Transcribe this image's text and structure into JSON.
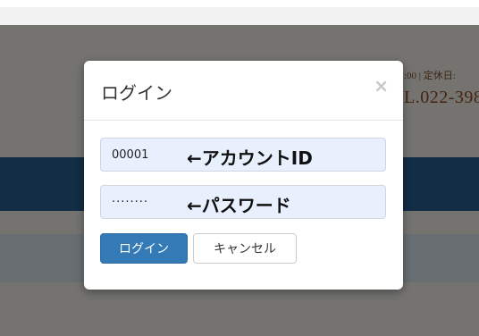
{
  "background": {
    "info_text": ":00 | 定休日:",
    "tel_text": "L.022-398"
  },
  "modal": {
    "title": "ログイン",
    "close_glyph": "×",
    "id_field": {
      "value": "00001",
      "note": "←アカウントID"
    },
    "password_field": {
      "value": "········",
      "note": "←パスワード"
    },
    "login_button": "ログイン",
    "cancel_button": "キャンセル"
  }
}
